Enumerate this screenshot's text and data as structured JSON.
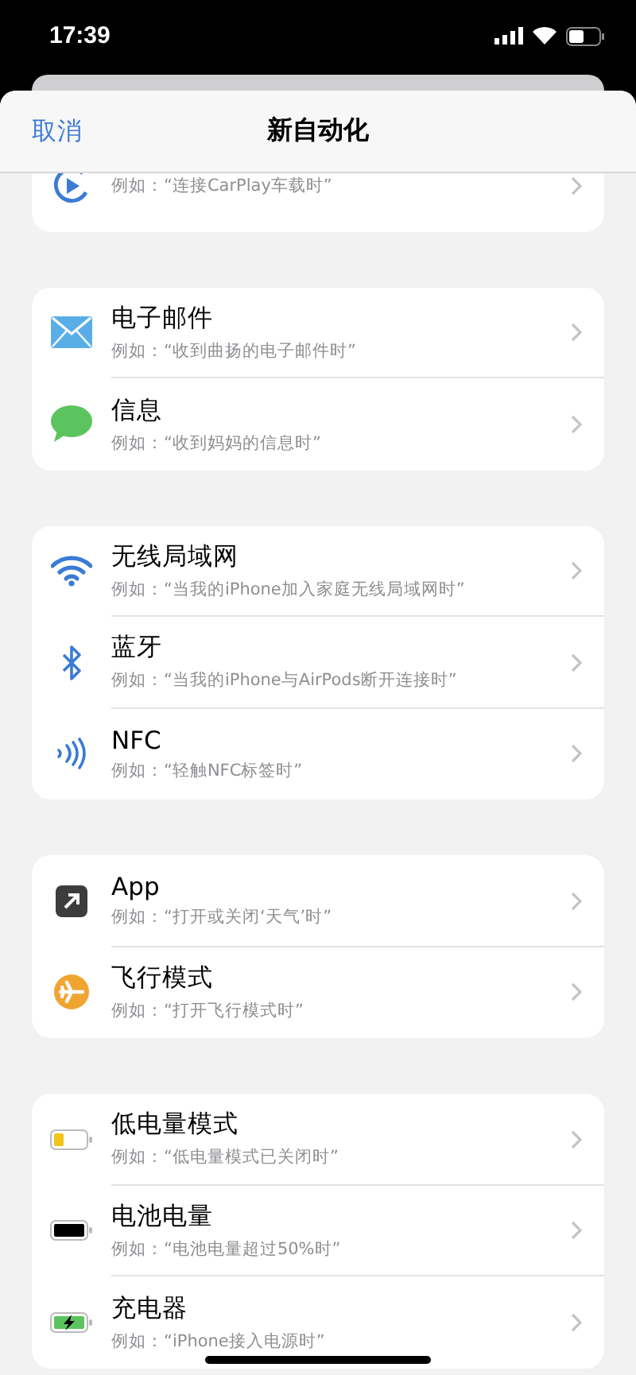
{
  "status_bar": {
    "time": "17:39"
  },
  "header": {
    "cancel": "取消",
    "title": "新自动化"
  },
  "groups": [
    {
      "rows": [
        {
          "kind": "carplay",
          "subtitle": "例如：“连接CarPlay车载时”"
        }
      ]
    },
    {
      "rows": [
        {
          "kind": "mail",
          "title": "电子邮件",
          "subtitle": "例如：“收到曲扬的电子邮件时”"
        },
        {
          "kind": "message",
          "title": "信息",
          "subtitle": "例如：“收到妈妈的信息时”"
        }
      ]
    },
    {
      "rows": [
        {
          "kind": "wifi",
          "title": "无线局域网",
          "subtitle": "例如：“当我的iPhone加入家庭无线局域网时”"
        },
        {
          "kind": "bluetooth",
          "title": "蓝牙",
          "subtitle": "例如：“当我的iPhone与AirPods断开连接时”"
        },
        {
          "kind": "nfc",
          "title": "NFC",
          "subtitle": "例如：“轻触NFC标签时”"
        }
      ]
    },
    {
      "rows": [
        {
          "kind": "app",
          "title": "App",
          "subtitle": "例如：“打开或关闭‘天气’时”"
        },
        {
          "kind": "airplane",
          "title": "飞行模式",
          "subtitle": "例如：“打开飞行模式时”"
        }
      ]
    },
    {
      "rows": [
        {
          "kind": "lowpower",
          "title": "低电量模式",
          "subtitle": "例如：“低电量模式已关闭时”"
        },
        {
          "kind": "battery",
          "title": "电池电量",
          "subtitle": "例如：“电池电量超过50%时”"
        },
        {
          "kind": "charger",
          "title": "充电器",
          "subtitle": "例如：“iPhone接入电源时”"
        }
      ]
    }
  ]
}
